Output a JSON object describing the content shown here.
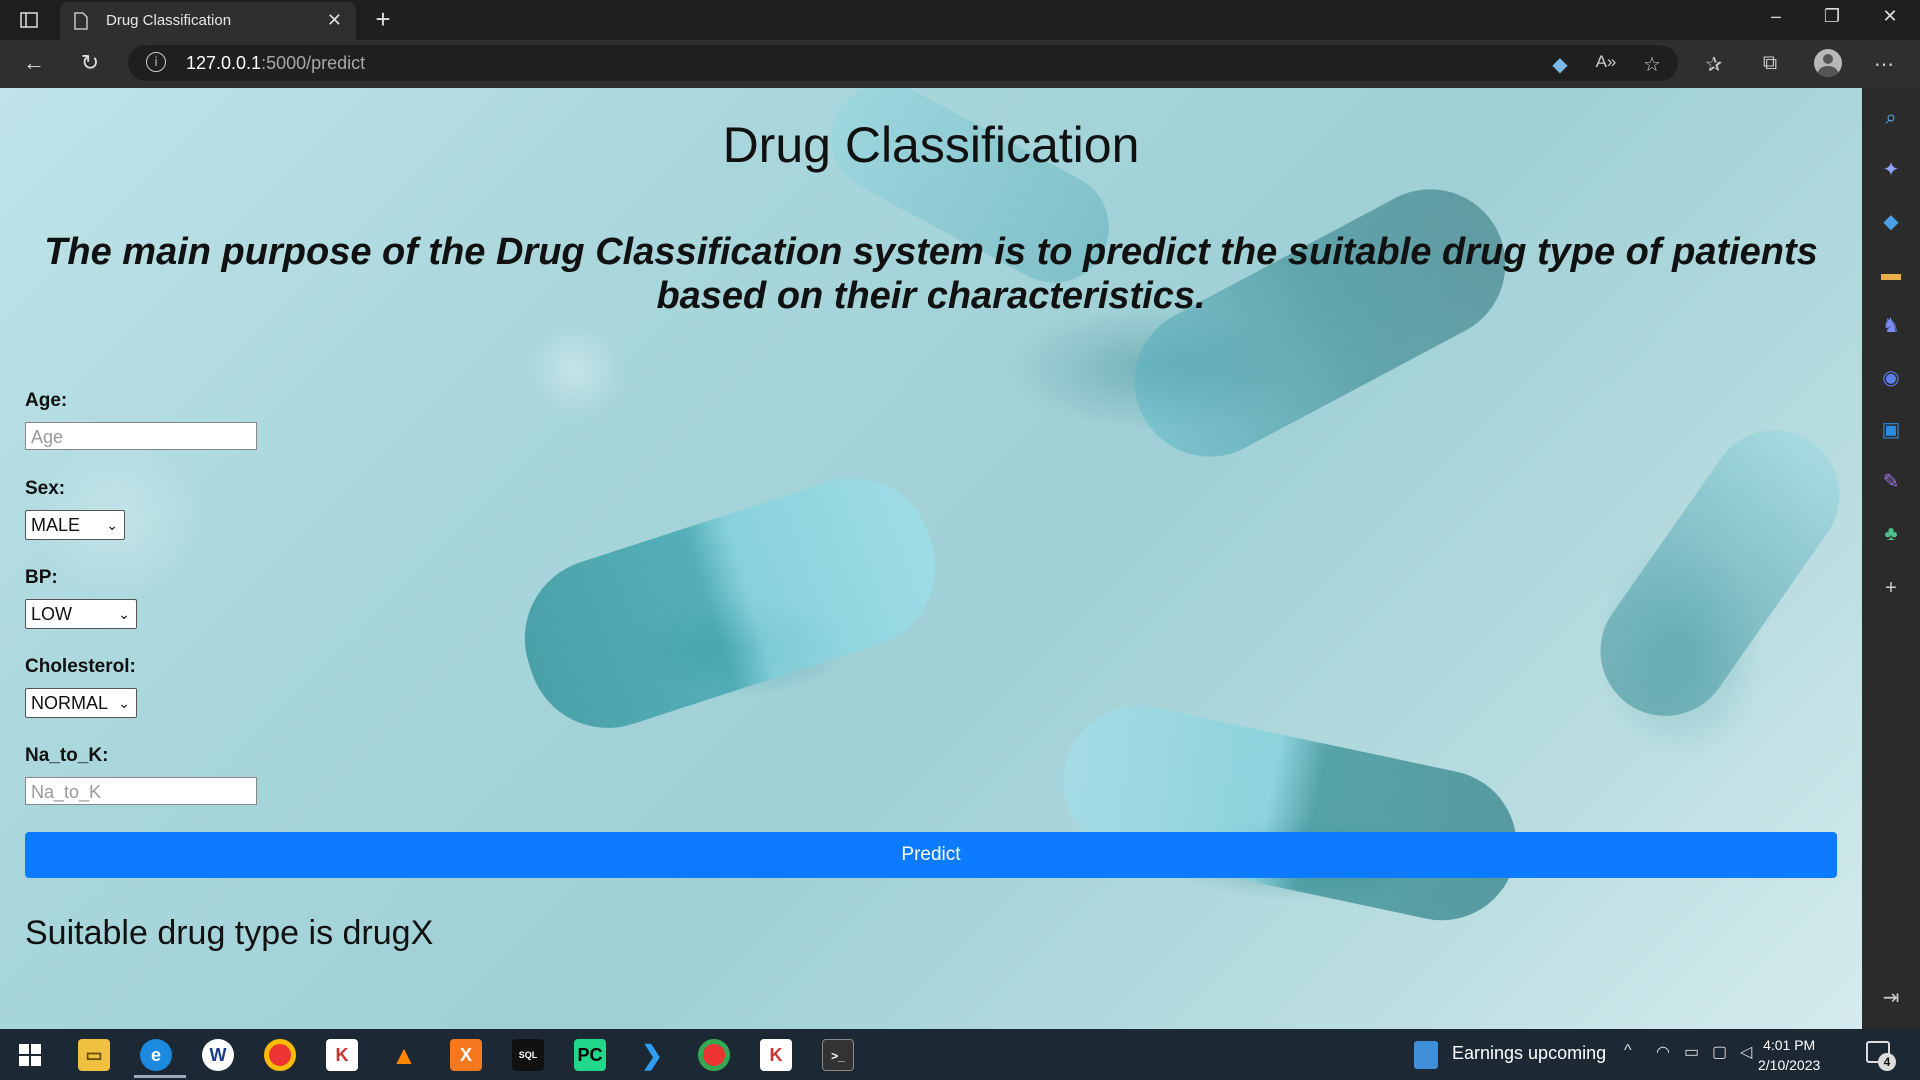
{
  "browser": {
    "tab_title": "Drug Classification",
    "url_host": "127.0.0.1",
    "url_path": ":5000/predict"
  },
  "page": {
    "heading": "Drug Classification",
    "tagline": "The main purpose of the Drug Classification system is to predict the suitable drug type of patients based on their characteristics.",
    "form": {
      "age_label": "Age:",
      "age_placeholder": "Age",
      "sex_label": "Sex:",
      "sex_value": "MALE",
      "bp_label": "BP:",
      "bp_value": "LOW",
      "chol_label": "Cholesterol:",
      "chol_value": "NORMAL",
      "na_label": "Na_to_K:",
      "na_placeholder": "Na_to_K",
      "predict_label": "Predict"
    },
    "result": "Suitable drug type is drugX",
    "accent_color": "#0d7bff"
  },
  "taskbar": {
    "news": "Earnings upcoming",
    "time": "4:01 PM",
    "date": "2/10/2023",
    "notifications": "4",
    "pinned": [
      "start-icon",
      "file-explorer-icon",
      "edge-icon",
      "app-w-icon",
      "chrome-icon",
      "app-ks-icon",
      "vlc-icon",
      "xampp-icon",
      "mysql-icon",
      "pycharm-icon",
      "vscode-icon",
      "chrome-profile-icon",
      "app-ks2-icon",
      "terminal-icon"
    ]
  }
}
